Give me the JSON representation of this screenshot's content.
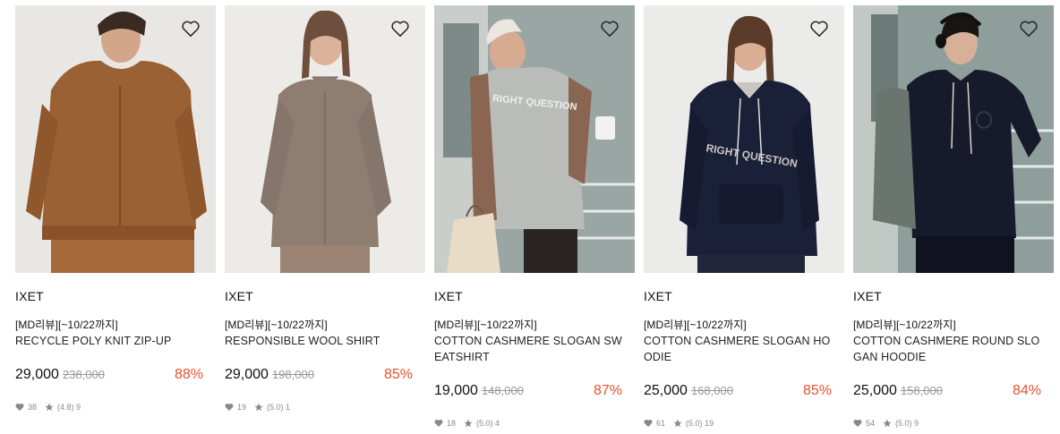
{
  "products": [
    {
      "brand": "IXET",
      "promo": "[MD리뷰][~10/22까지]",
      "name": "RECYCLE POLY KNIT ZIP-UP",
      "price": "29,000",
      "original_price": "238,000",
      "discount": "88%",
      "likes": "38",
      "rating": "(4.8) 9",
      "colors": {
        "bg": "#e9e7e3",
        "garment": "#9a6234",
        "accent": "#c7e3a2"
      }
    },
    {
      "brand": "IXET",
      "promo": "[MD리뷰][~10/22까지]",
      "name": "RESPONSIBLE WOOL SHIRT",
      "price": "29,000",
      "original_price": "198,000",
      "discount": "85%",
      "likes": "19",
      "rating": "(5.0) 1",
      "colors": {
        "bg": "#ecebe8",
        "garment": "#8e7d70",
        "accent": "#6e4e3c"
      }
    },
    {
      "brand": "IXET",
      "promo": "[MD리뷰][~10/22까지]",
      "name": "COTTON CASHMERE SLOGAN SWEATSHIRT",
      "price": "19,000",
      "original_price": "148,000",
      "discount": "87%",
      "likes": "18",
      "rating": "(5.0) 4",
      "colors": {
        "bg": "#9aa6a4",
        "garment": "#b9bcb8",
        "accent": "#8a6552"
      }
    },
    {
      "brand": "IXET",
      "promo": "[MD리뷰][~10/22까지]",
      "name": "COTTON CASHMERE SLOGAN HOODIE",
      "price": "25,000",
      "original_price": "168,000",
      "discount": "85%",
      "likes": "61",
      "rating": "(5.0) 19",
      "colors": {
        "bg": "#ebebea",
        "garment": "#1b2039",
        "accent": "#c9c5c0"
      }
    },
    {
      "brand": "IXET",
      "promo": "[MD리뷰][~10/22까지]",
      "name": "COTTON CASHMERE ROUND SLOGAN HOODIE",
      "price": "25,000",
      "original_price": "158,000",
      "discount": "84%",
      "likes": "54",
      "rating": "(5.0) 9",
      "colors": {
        "bg": "#8e9e9a",
        "garment": "#161a2b",
        "accent": "#6b7570"
      }
    }
  ]
}
